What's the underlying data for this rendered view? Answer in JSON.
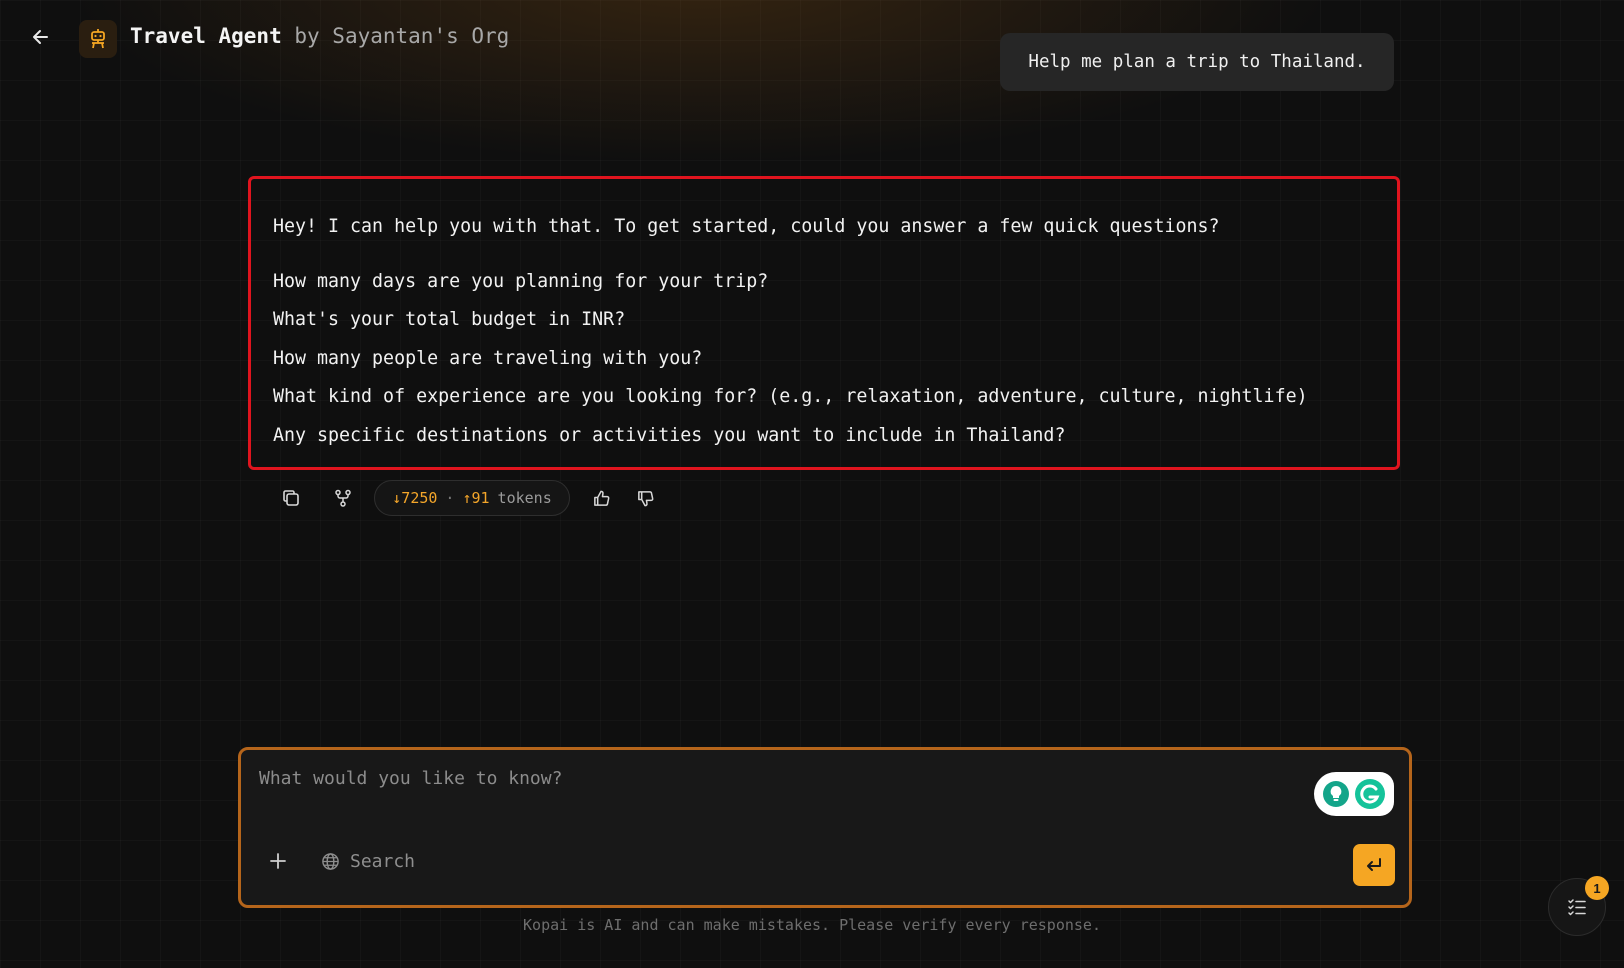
{
  "header": {
    "agent_name": "Travel Agent",
    "by_text": "by Sayantan's Org"
  },
  "user_message": "Help me plan a trip to Thailand.",
  "assistant_message": {
    "intro": "Hey! I can help you with that. To get started, could you answer a few quick questions?",
    "questions": [
      "How many days are you planning for your trip?",
      "What's your total budget in INR?",
      "How many people are traveling with you?",
      "What kind of experience are you looking for? (e.g., relaxation, adventure, culture, nightlife)",
      "Any specific destinations or activities you want to include in Thailand?"
    ]
  },
  "message_actions": {
    "tokens_in": "↓7250",
    "separator": "·",
    "tokens_out": "↑91",
    "tokens_label": "tokens"
  },
  "composer": {
    "placeholder": "What would you like to know?",
    "search_label": "Search"
  },
  "disclaimer": "Kopai is AI and can make mistakes. Please verify every response.",
  "task_badge_count": "1",
  "colors": {
    "accent": "#f5a623",
    "highlight_border": "#e0141e",
    "composer_border": "#b5651b"
  },
  "icons": {
    "back": "arrow-left-icon",
    "agent": "robot-icon",
    "copy": "copy-icon",
    "branch": "git-branch-icon",
    "like": "thumbs-up-icon",
    "dislike": "thumbs-down-icon",
    "plus": "plus-icon",
    "globe": "globe-icon",
    "send": "enter-icon",
    "tasks": "checklist-icon"
  }
}
